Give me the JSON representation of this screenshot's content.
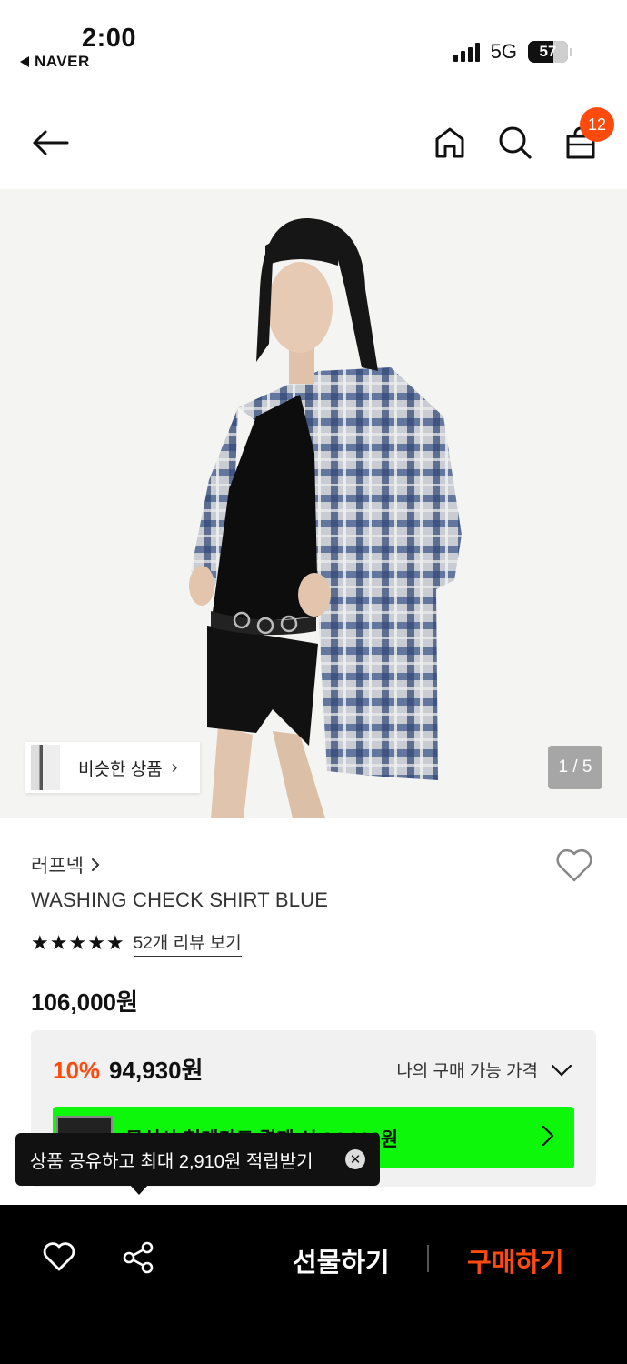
{
  "status": {
    "time": "2:00",
    "back_app": "NAVER",
    "network": "5G",
    "battery": "57"
  },
  "nav": {
    "icons": [
      "arrow-left-icon",
      "home-icon",
      "search-icon",
      "shopping-bag-icon"
    ],
    "cart_count": "12"
  },
  "hero": {
    "similar_label": "비슷한 상품",
    "page_counter": "1 / 5"
  },
  "product": {
    "brand": "러프넥",
    "name": "WASHING CHECK SHIRT BLUE",
    "rating_stars": 5,
    "review_link": "52개 리뷰 보기",
    "price": "106,000원"
  },
  "price_box": {
    "discount_rate": "10%",
    "discount_price": "94,930원",
    "my_price_label": "나의 구매 가능 가격",
    "card_banner_text": "무신사 현대카드 결제 시 94,930원"
  },
  "tooltip": {
    "text": "상품 공유하고 최대 2,910원 적립받기"
  },
  "bottom_bar": {
    "gift_label": "선물하기",
    "buy_label": "구매하기"
  },
  "colors": {
    "accent": "#ff4a0d",
    "banner_green": "#0cf70a"
  }
}
